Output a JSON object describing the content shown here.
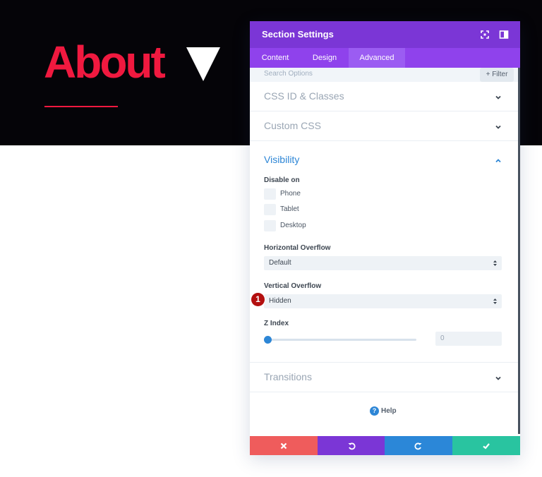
{
  "page": {
    "hero_title": "About"
  },
  "modal": {
    "title": "Section Settings",
    "header_icons": [
      "expand-icon",
      "split-view-icon"
    ],
    "tabs": [
      {
        "label": "Content",
        "active": false
      },
      {
        "label": "Design",
        "active": false
      },
      {
        "label": "Advanced",
        "active": true
      }
    ],
    "search": {
      "placeholder": "Search Options",
      "filter_label": "+ Filter"
    },
    "sections": {
      "css_id": "CSS ID & Classes",
      "custom_css": "Custom CSS",
      "visibility": "Visibility",
      "transitions": "Transitions"
    },
    "visibility": {
      "disable_on_label": "Disable on",
      "options": [
        {
          "label": "Phone",
          "checked": false
        },
        {
          "label": "Tablet",
          "checked": false
        },
        {
          "label": "Desktop",
          "checked": false
        }
      ],
      "horizontal_overflow": {
        "label": "Horizontal Overflow",
        "value": "Default"
      },
      "vertical_overflow": {
        "label": "Vertical Overflow",
        "value": "Hidden"
      },
      "z_index": {
        "label": "Z Index",
        "value": "0"
      }
    },
    "step_marker": "1",
    "help_label": "Help",
    "footer_icons": [
      "close-icon",
      "undo-icon",
      "redo-icon",
      "check-icon"
    ]
  },
  "colors": {
    "accent_red": "#f0193f",
    "header_purple": "#7b36d6",
    "tabs_purple": "#8f42ec",
    "link_blue": "#2d86d6",
    "cancel": "#ef5c5c",
    "undo": "#7b36d6",
    "redo": "#2b87d8",
    "save": "#29c4a0"
  }
}
